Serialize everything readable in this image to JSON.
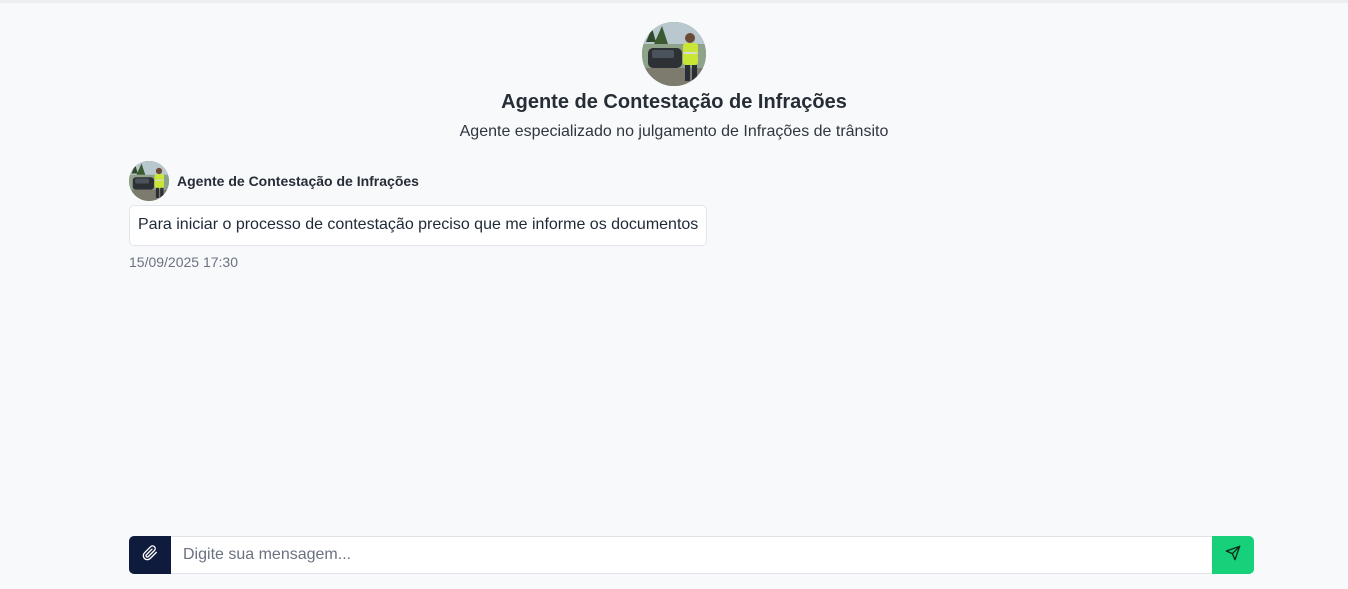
{
  "header": {
    "agent_name": "Agente de Contestação de Infrações",
    "agent_description": "Agente especializado no julgamento de Infrações de trânsito",
    "avatar_icon": "traffic-agent-photo"
  },
  "messages": [
    {
      "sender": "Agente de Contestação de Infrações",
      "text": "Para iniciar o processo de contestação preciso que me informe os documentos",
      "timestamp": "15/09/2025 17:30"
    }
  ],
  "composer": {
    "placeholder": "Digite sua mensagem...",
    "value": "",
    "attach_icon": "paperclip-icon",
    "send_icon": "send-icon"
  },
  "colors": {
    "attach_button": "#0f1b3d",
    "send_button": "#16d17a",
    "background": "#f8f9fb"
  }
}
